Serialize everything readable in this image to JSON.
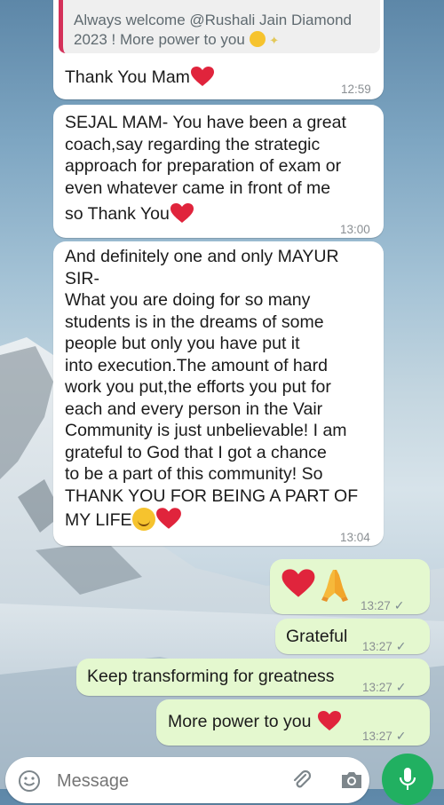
{
  "quoted_message": {
    "text_line1": "Always welcome @Rushali Jain Diamond",
    "text_line2": "2023 ! More power to you"
  },
  "messages": [
    {
      "direction": "incoming",
      "text": "Thank You Mam",
      "time": "12:59"
    },
    {
      "direction": "incoming",
      "lines": [
        "SEJAL MAM- You have been a great",
        "coach,say regarding the strategic",
        "approach for preparation of exam or",
        "even whatever came in front of me",
        "so Thank You"
      ],
      "time": "13:00"
    },
    {
      "direction": "incoming",
      "lines": [
        "And definitely one and only MAYUR",
        "SIR-",
        "What you are doing for so many",
        "students is in the dreams of some",
        "people but only you have put it",
        "into execution.The amount of hard",
        "work you put,the efforts you put for",
        "each and every person in the Vair",
        "Community is just unbelievable! I am",
        "grateful to God that I got a chance",
        "to be a part of this community! So",
        "THANK YOU FOR BEING A PART OF",
        "MY LIFE"
      ],
      "time": "13:04"
    },
    {
      "direction": "outgoing",
      "text": "",
      "time": "13:27"
    },
    {
      "direction": "outgoing",
      "text": "Grateful",
      "time": "13:27"
    },
    {
      "direction": "outgoing",
      "text": "Keep transforming for greatness",
      "time": "13:27"
    },
    {
      "direction": "outgoing",
      "text": "More power to you",
      "time": "13:27"
    }
  ],
  "input": {
    "placeholder": "Message"
  },
  "colors": {
    "outgoing_bubble": "#e4f8cf",
    "incoming_bubble": "#ffffff",
    "mic_button": "#21b061",
    "heart": "#e0243c"
  }
}
